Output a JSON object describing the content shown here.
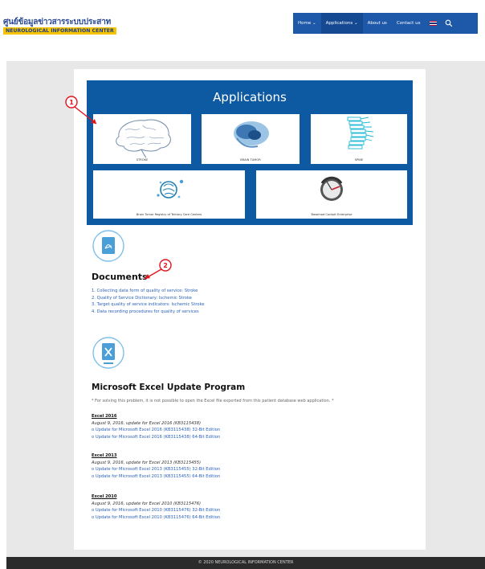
{
  "header": {
    "logo_thai": "ศูนย์ข้อมูลข่าวสารระบบประสาท",
    "logo_en": "NEUROLOGICAL INFORMATION CENTER"
  },
  "nav": {
    "items": [
      {
        "label": "Home ⌄"
      },
      {
        "label": "Applications ⌄"
      },
      {
        "label": "About us"
      },
      {
        "label": "Contact us"
      }
    ],
    "flag_icon": "thai-flag-icon",
    "search_icon": "search-icon"
  },
  "applications": {
    "title": "Applications",
    "tiles": [
      {
        "label": "STROKE",
        "icon": "brain-icon"
      },
      {
        "label": "BRAIN TUMOR",
        "icon": "brain-tumor-icon"
      },
      {
        "label": "SPINE",
        "icon": "spine-icon"
      },
      {
        "label": "Brain Tumor Registry of Tertiary Care Centers",
        "icon": "registry-icon"
      },
      {
        "label": "Basemod Cockpit Enterprise",
        "icon": "cockpit-icon"
      }
    ]
  },
  "annotations": {
    "one": "1",
    "two": "2"
  },
  "documents": {
    "icon": "pdf-file-icon",
    "heading": "Documents",
    "links": [
      "1. Collecting data form of quality of service: Stroke",
      "2. Quality of Service Dictionary: Ischemic Stroke",
      "3. Target quality of service indicators: Ischemic Stroke",
      "4. Data recording procedures for quality of services"
    ]
  },
  "excel": {
    "icon": "excel-file-icon",
    "heading": "Microsoft Excel Update Program",
    "note": "* For solving this problem, it is not possible to open the Excel file exported from this patient database web application. *",
    "groups": [
      {
        "title": "Excel 2016",
        "date": "August 9, 2016, update for Excel 2016 (KB3115438)",
        "links": [
          "o Update for Microsoft Excel 2016 (KB3115438) 32-Bit Edition",
          "o Update for Microsoft Excel 2016 (KB3115438) 64-Bit Edition"
        ]
      },
      {
        "title": "Excel 2013",
        "date": "August 9, 2016, update for Excel 2013 (KB3115455)",
        "links": [
          "o Update for Microsoft Excel 2013 (KB3115455) 32-Bit Edition",
          "o Update for Microsoft Excel 2013 (KB3115455) 64-Bit Edition"
        ]
      },
      {
        "title": "Excel 2010",
        "date": "August 9, 2016, update for Excel 2010 (KB3115476)",
        "links": [
          "o Update for Microsoft Excel 2010 (KB3115476) 32-Bit Edition",
          "o Update for Microsoft Excel 2010 (KB3115476) 64-Bit Edition"
        ]
      }
    ]
  },
  "footer": {
    "text": "© 2020 NEUROLOGICAL INFORMATION CENTER"
  },
  "colors": {
    "nav_bg": "#1e58a8",
    "panel_bg": "#0d5aa3",
    "link": "#2b62b8",
    "annotation": "#e0141e",
    "accent_icon": "#4a9fd8"
  }
}
